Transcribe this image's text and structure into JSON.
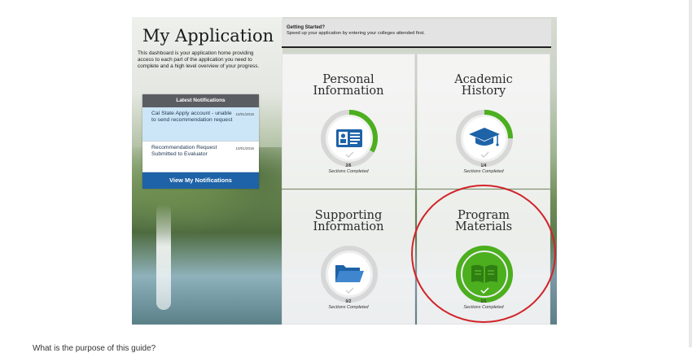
{
  "dashboard": {
    "title": "My Application",
    "description": "This dashboard is your application home providing access to each part of the application you need to complete and a high level overview of your progress."
  },
  "notifications": {
    "header": "Latest Notifications",
    "items": [
      {
        "text": "Cal State Apply account - unable to send recommendation request",
        "date": "10/01/2015"
      },
      {
        "text": "Recommendation Request Submitted to Evaluator",
        "date": "10/01/2015"
      }
    ],
    "button_label": "View My Notifications"
  },
  "banner": {
    "title": "Getting Started?",
    "text": "Speed up your application by entering your colleges attended first."
  },
  "tiles": [
    {
      "title_line1": "Personal",
      "title_line2": "Information",
      "progress": "2/6",
      "progress_value": 0.333,
      "caption": "Sections Completed",
      "icon": "id-card-icon"
    },
    {
      "title_line1": "Academic",
      "title_line2": "History",
      "progress": "1/4",
      "progress_value": 0.25,
      "caption": "Sections Completed",
      "icon": "graduation-cap-icon"
    },
    {
      "title_line1": "Supporting",
      "title_line2": "Information",
      "progress": "0/2",
      "progress_value": 0,
      "caption": "Sections Completed",
      "icon": "folder-icon"
    },
    {
      "title_line1": "Program",
      "title_line2": "Materials",
      "progress": "1/1",
      "progress_value": 1,
      "caption": "Sections Completed",
      "icon": "book-icon"
    }
  ],
  "colors": {
    "accent": "#1e62a8",
    "progress": "#4caf1e",
    "highlight": "#d2232a"
  },
  "footer_text": "What is the purpose of this guide?"
}
